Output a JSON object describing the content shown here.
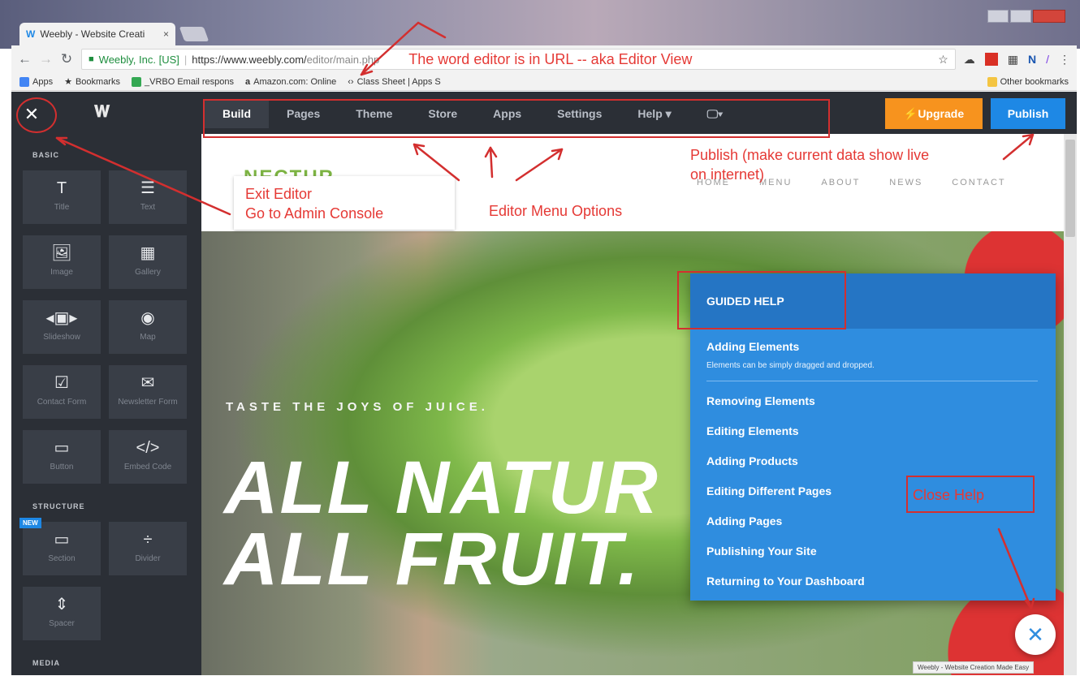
{
  "browser": {
    "tab_title": "Weebly - Website Creati",
    "tab_close": "×",
    "origin": "Weebly, Inc. [US]",
    "url_host": "https://www.weebly.com/",
    "url_path": "editor/main.php",
    "bookmarks": [
      {
        "label": "Apps",
        "color": "#4285f4"
      },
      {
        "label": "Bookmarks",
        "color": "#333333"
      },
      {
        "label": "_VRBO Email respons",
        "color": "#34a853"
      },
      {
        "label": "Amazon.com: Online",
        "color": "#222222"
      },
      {
        "label": "Class Sheet | Apps S",
        "color": "#666666"
      }
    ],
    "other_bookmarks": "Other bookmarks"
  },
  "editor": {
    "menu": [
      "Build",
      "Pages",
      "Theme",
      "Store",
      "Apps",
      "Settings",
      "Help ▾",
      "🖵▾"
    ],
    "upgrade_label": "⚡Upgrade",
    "publish_label": "Publish",
    "accent_orange": "#f7931e",
    "accent_blue": "#1e88e5"
  },
  "sidebar": {
    "basic_heading": "BASIC",
    "structure_heading": "STRUCTURE",
    "media_heading": "MEDIA",
    "new_badge": "NEW",
    "tiles": [
      {
        "label": "Title",
        "icon": "T",
        "icon_name": "title-icon"
      },
      {
        "label": "Text",
        "icon": "☰",
        "icon_name": "text-icon"
      },
      {
        "label": "Image",
        "icon": "🖼",
        "icon_name": "image-icon"
      },
      {
        "label": "Gallery",
        "icon": "▦",
        "icon_name": "gallery-icon"
      },
      {
        "label": "Slideshow",
        "icon": "◂▣▸",
        "icon_name": "slideshow-icon"
      },
      {
        "label": "Map",
        "icon": "◉",
        "icon_name": "map-icon"
      },
      {
        "label": "Contact Form",
        "icon": "☑",
        "icon_name": "contact-form-icon"
      },
      {
        "label": "Newsletter Form",
        "icon": "✉",
        "icon_name": "newsletter-icon"
      },
      {
        "label": "Button",
        "icon": "▭",
        "icon_name": "button-icon"
      },
      {
        "label": "Embed Code",
        "icon": "</>",
        "icon_name": "embed-code-icon"
      },
      {
        "label": "Section",
        "icon": "▭",
        "icon_name": "section-icon"
      },
      {
        "label": "Divider",
        "icon": "÷",
        "icon_name": "divider-icon"
      },
      {
        "label": "Spacer",
        "icon": "⇕",
        "icon_name": "spacer-icon"
      }
    ]
  },
  "site": {
    "logo": "NECTUR",
    "nav": [
      "HOME",
      "MENU",
      "ABOUT",
      "NEWS",
      "CONTACT"
    ],
    "tagline": "TASTE THE JOYS OF JUICE.",
    "headline_1": "ALL NATUR",
    "headline_2": "ALL FRUIT."
  },
  "help": {
    "heading": "GUIDED HELP",
    "first_item": "Adding Elements",
    "first_desc": "Elements can be simply dragged and dropped.",
    "items": [
      "Removing Elements",
      "Editing Elements",
      "Adding Products",
      "Editing Different Pages",
      "Adding Pages",
      "Publishing Your Site",
      "Returning to Your Dashboard"
    ],
    "footer_tag": "Weebly - Website Creation Made Easy"
  },
  "annotations": {
    "url_note": "The word editor is in URL -- aka Editor View",
    "exit_line1": "Exit Editor",
    "exit_line2": "Go to Admin Console",
    "menu_note": "Editor Menu Options",
    "publish_line1": "Publish (make current data show live",
    "publish_line2": "on internet)",
    "close_help": "Close Help",
    "color": "#e53935"
  }
}
